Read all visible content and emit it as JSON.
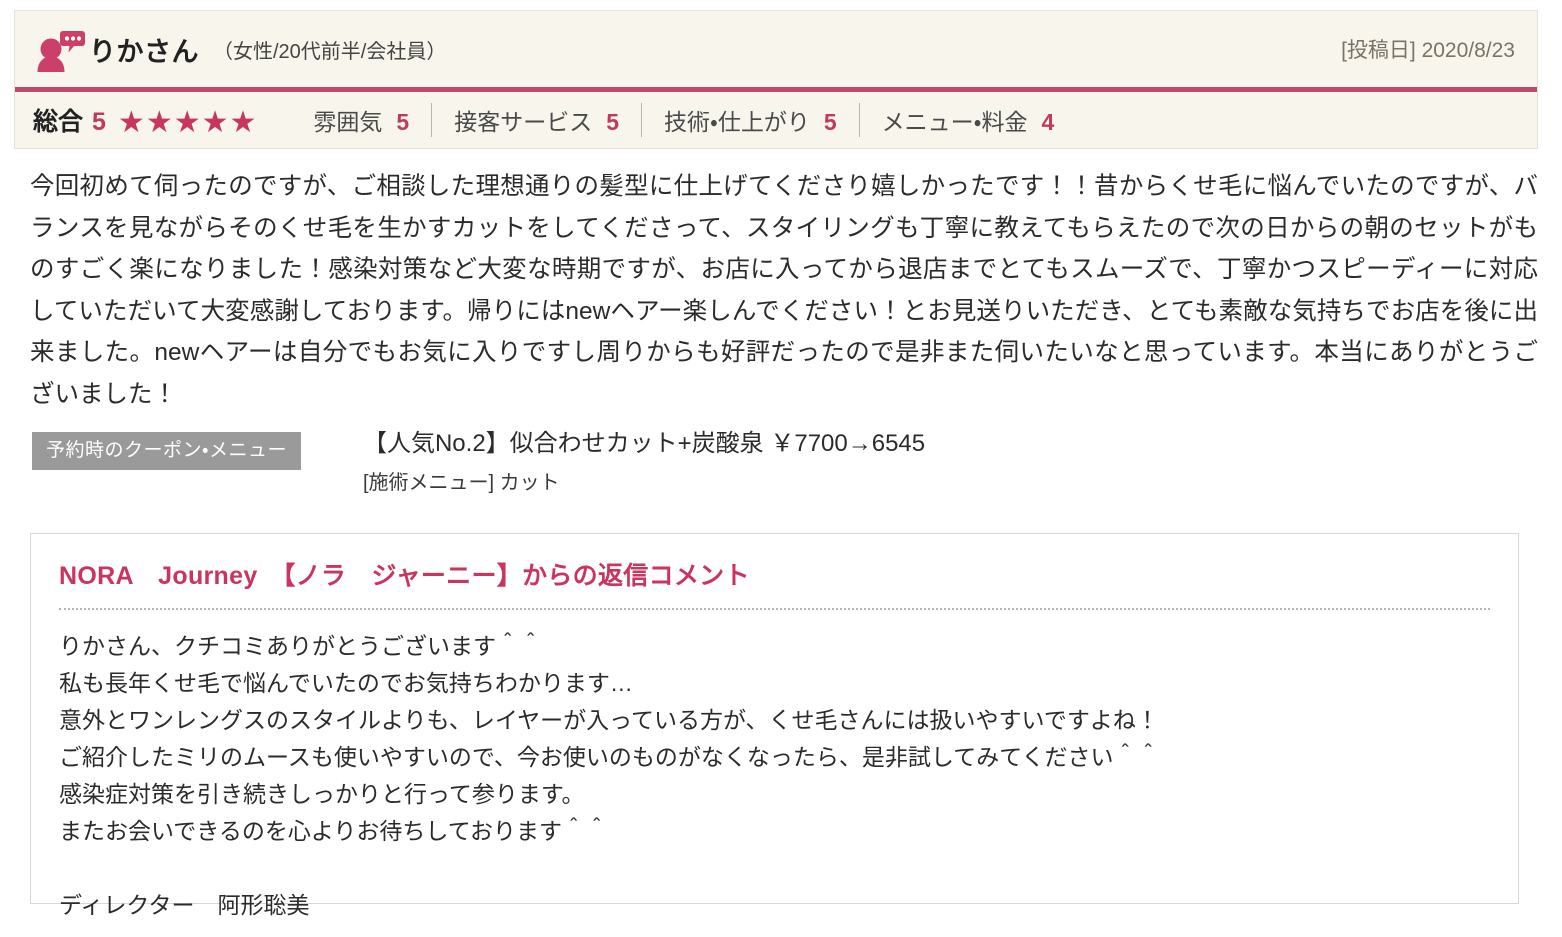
{
  "review": {
    "avatar_icon": "person-speech-bubble-icon",
    "reviewer_name": "りかさん",
    "reviewer_meta": "（女性/20代前半/会社員）",
    "post_date": "[投稿日] 2020/8/23",
    "accent_color": "#c0496d",
    "score_color": "#c0395f",
    "panel_bg": "#f7f5ec"
  },
  "ratings": {
    "total": {
      "label": "総合",
      "score": "5",
      "stars": "★★★★★",
      "star_count": 5
    },
    "items": [
      {
        "label": "雰囲気",
        "score": "5"
      },
      {
        "label": "接客サービス",
        "score": "5"
      },
      {
        "label": "技術・仕上がり",
        "score": "5"
      },
      {
        "label": "メニュー・料金",
        "score": "4"
      }
    ]
  },
  "body": {
    "text": "今回初めて伺ったのですが、ご相談した理想通りの髪型に仕上げてくださり嬉しかったです！！昔からくせ毛に悩んでいたのですが、バランスを見ながらそのくせ毛を生かすカットをしてくださって、スタイリングも丁寧に教えてもらえたので次の日からの朝のセットがものすごく楽になりました！感染対策など大変な時期ですが、お店に入ってから退店までとてもスムーズで、丁寧かつスピーディーに対応していただいて大変感謝しております。帰りにはnewヘアー楽しんでください！とお見送りいただき、とても素敵な気持ちでお店を後に出来ました。newヘアーは自分でもお気に入りですし周りからも好評だったので是非また伺いたいなと思っています。本当にありがとうございました！"
  },
  "coupon": {
    "badge_label": "予約時のクーポン・メニュー",
    "badge_color": "#9a9a9a",
    "coupon_name": "【人気No.2】似合わせカット+炭酸泉 ￥7700→6545",
    "service_menu": "[施術メニュー] カット"
  },
  "reply": {
    "title": "NORA　Journey　【ノラ　ジャーニー】からの返信コメント",
    "title_color": "#c9355e",
    "lines": [
      "りかさん、クチコミありがとうございます＾＾",
      "私も長年くせ毛で悩んでいたのでお気持ちわかります…",
      "意外とワンレングスのスタイルよりも、レイヤーが入っている方が、くせ毛さんには扱いやすいですよね！",
      "ご紹介したミリのムースも使いやすいので、今お使いのものがなくなったら、是非試してみてください＾＾",
      "感染症対策を引き続きしっかりと行って参ります。",
      "またお会いできるのを心よりお待ちしております＾＾"
    ],
    "signature": "ディレクター　阿形聡美"
  }
}
